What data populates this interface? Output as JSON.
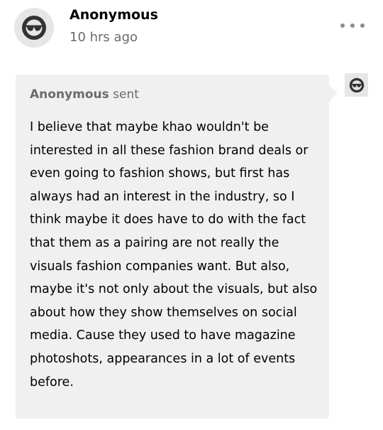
{
  "post": {
    "author": "Anonymous",
    "timestamp": "10 hrs ago",
    "avatar_icon": "anonymous-sunglasses-icon",
    "menu_icon": "more-horizontal-icon"
  },
  "ask": {
    "asker_name": "Anonymous",
    "sent_label": "sent",
    "asker_avatar_icon": "anonymous-sunglasses-icon",
    "question": "I believe that maybe khao wouldn't be interested in all these fashion brand deals or even going to fashion shows, but first has always had an interest in the industry, so I think maybe it does have to do with the fact that them as a pairing are not really the visuals fashion companies want. But also, maybe it's not only about the visuals, but also about how they show themselves on social media. Cause they used to have magazine photoshots, appearances in a lot of events before."
  },
  "colors": {
    "bubble_background": "#f0f0f0",
    "muted_text": "#6b6b6b",
    "avatar_background": "#e6e6e6"
  }
}
